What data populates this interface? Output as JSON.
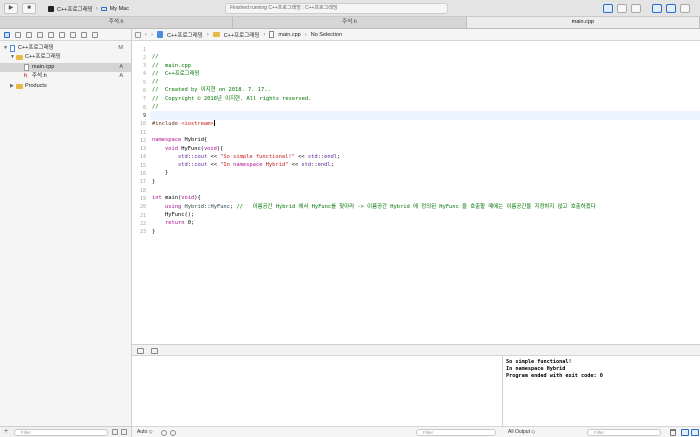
{
  "toolbar": {
    "scheme_target": "C++프로그래밍",
    "destination": "My Mac",
    "status": "Finished running C++프로그래밍 : C++프로그래밍"
  },
  "tabs": [
    {
      "label": "주석.h",
      "active": false
    },
    {
      "label": "주석.h",
      "active": false
    },
    {
      "label": "main.cpp",
      "active": true
    }
  ],
  "navigator": {
    "project": {
      "label": "C++프로그래밍",
      "badge": "M"
    },
    "group": {
      "label": "C++프로그래밍"
    },
    "files": [
      {
        "label": "main.cpp",
        "badge": "A",
        "selected": true
      },
      {
        "label": "주석.h",
        "badge": "A",
        "selected": false
      }
    ],
    "products": {
      "label": "Products"
    },
    "filter_placeholder": "Filter"
  },
  "jumpbar": {
    "crumbs": [
      "C++프로그래밍",
      "C++프로그래밍",
      "main.cpp",
      "No Selection"
    ]
  },
  "editor": {
    "current_line": 9,
    "lines": [
      "//",
      "//  main.cpp",
      "//  C++프로그래밍",
      "//",
      "//  Created by 이지현 on 2018. 7. 17..",
      "//  Copyright © 2018년 이지현. All rights reserved.",
      "//",
      "",
      "#include <iostream>",
      "",
      "namespace Hybrid{",
      "    void HyFunc(void){",
      "        std::cout << \"So simple functional!\" << std::endl;",
      "        std::cout << \"In namespace Hybrid\" << std::endl;",
      "    }",
      "}",
      "",
      "int main(void){",
      "    using Hybrid::HyFunc; //   이름공간 Hybrid 에서 HyFunc를 찾아라 -> 이름공간 Hybrid 에 정의된 HyFunc 을 호출할 때에는 이름공간을 지정하지 않고 호출하겠다",
      "    HyFunc();",
      "    return 0;",
      "}",
      ""
    ]
  },
  "variables": {
    "scope": "Auto ◇",
    "filter_placeholder": "Filter"
  },
  "console": {
    "output": "So simple functional!\nIn namespace Hybrid\nProgram ended with exit code: 0",
    "selector": "All Output ◇",
    "filter_placeholder": "Filter"
  }
}
